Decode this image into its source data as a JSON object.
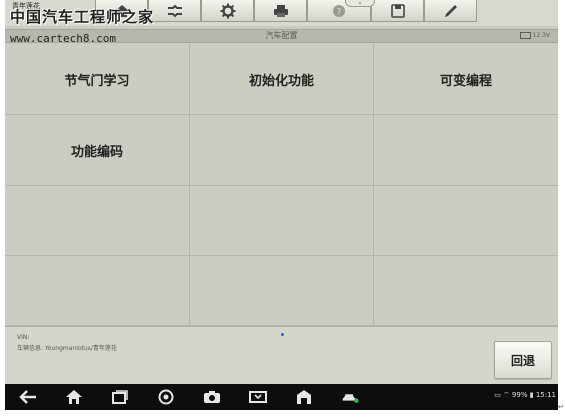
{
  "watermark": {
    "small": "青年莲花",
    "title": "中国汽车工程师之家",
    "url": "www.cartech8.com"
  },
  "toolbar": {
    "icons": [
      "home-icon",
      "connector-icon",
      "gear-icon",
      "printer-icon",
      "help-icon",
      "save-icon",
      "pen-icon"
    ]
  },
  "subbar": {
    "title": "汽车配置",
    "battery": "12.3V"
  },
  "grid": {
    "cells": [
      "节气门学习",
      "初始化功能",
      "可变编程",
      "功能编码",
      "",
      "",
      "",
      "",
      "",
      "",
      "",
      ""
    ]
  },
  "info": {
    "vin": "VIN:",
    "vehicle": "车辆信息: Youngmanlotus/青年莲花"
  },
  "back_button": "回退",
  "status": {
    "text": "99%",
    "time": "15:11"
  },
  "colors": {
    "panel": "#cacdc2",
    "navbar": "#0d0d0d"
  }
}
